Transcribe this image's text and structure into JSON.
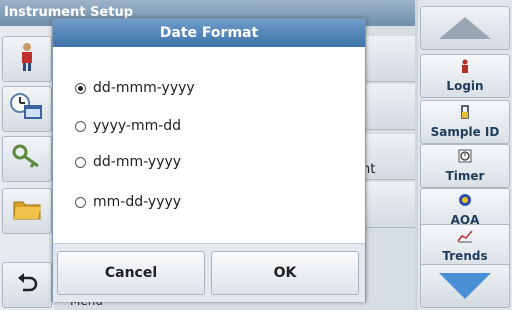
{
  "window": {
    "title": "Instrument Setup"
  },
  "dialog": {
    "title": "Date Format",
    "options": [
      {
        "label": "dd-mmm-yyyy",
        "selected": true
      },
      {
        "label": "yyyy-mm-dd",
        "selected": false
      },
      {
        "label": "dd-mm-yyyy",
        "selected": false
      },
      {
        "label": "mm-dd-yyyy",
        "selected": false
      }
    ],
    "cancel_label": "Cancel",
    "ok_label": "OK"
  },
  "background": {
    "partial_row_text": "nt",
    "partial_menu_text": "Menu"
  },
  "right_sidebar": {
    "items": [
      {
        "label": "Login",
        "icon": "person-icon"
      },
      {
        "label": "Sample ID",
        "icon": "sample-vial-icon"
      },
      {
        "label": "Timer",
        "icon": "timer-icon"
      },
      {
        "label": "AQA",
        "icon": "aqa-icon"
      },
      {
        "label": "Trends",
        "icon": "trend-chart-icon"
      }
    ]
  },
  "left_sidebar": {
    "icons": [
      "operator-icon",
      "datetime-icon",
      "key-icon",
      "folder-icon",
      "back-icon"
    ]
  },
  "colors": {
    "title_bar": "#3f74aa",
    "accent_arrow": "#4a8fd3"
  }
}
